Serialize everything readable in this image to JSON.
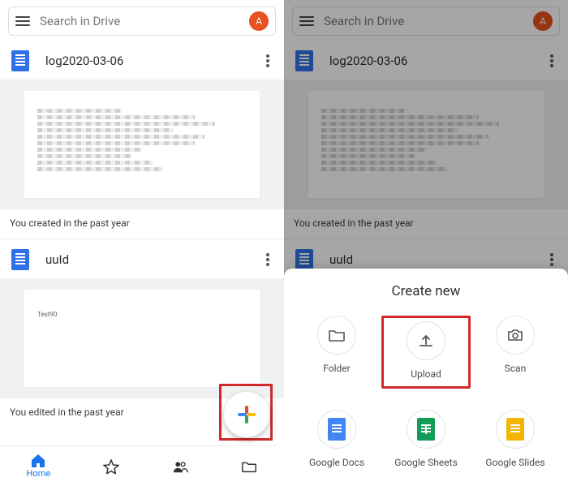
{
  "search": {
    "placeholder": "Search in Drive",
    "avatar_letter": "A"
  },
  "files": [
    {
      "name": "log2020-03-06",
      "caption": "You created in the past year"
    },
    {
      "name": "uuId",
      "caption": "You edited in the past year",
      "preview_text": "Test90"
    }
  ],
  "nav": {
    "home": "Home"
  },
  "sheet": {
    "title": "Create new",
    "items": {
      "folder": "Folder",
      "upload": "Upload",
      "scan": "Scan",
      "docs": "Google Docs",
      "sheets": "Google Sheets",
      "slides": "Google Slides"
    }
  }
}
